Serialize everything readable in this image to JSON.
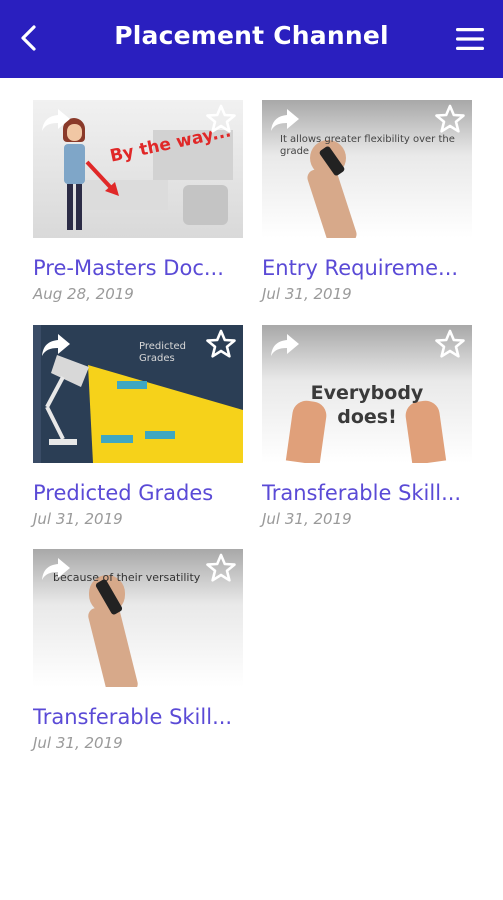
{
  "header": {
    "title": "Placement Channel",
    "back_icon": "arrow-back-icon",
    "menu_icon": "hamburger-menu-icon",
    "background": "#2a1fbf"
  },
  "videos": [
    {
      "title": "Pre-Masters Doc...",
      "date": "Aug 28, 2019",
      "thumb_text": "By the way..."
    },
    {
      "title": "Entry Requireme...",
      "date": "Jul 31, 2019",
      "thumb_text": "It allows greater flexibility over the grade"
    },
    {
      "title": "Predicted Grades",
      "date": "Jul 31, 2019",
      "thumb_text": "Predicted Grades"
    },
    {
      "title": "Transferable Skill...",
      "date": "Jul 31, 2019",
      "thumb_text": "Everybody does!"
    },
    {
      "title": "Transferable Skill...",
      "date": "Jul 31, 2019",
      "thumb_text": "because of their versatility"
    }
  ],
  "colors": {
    "accent": "#2a1fbf",
    "title_text": "#5a4ad6",
    "date_text": "#9a9a9a"
  }
}
